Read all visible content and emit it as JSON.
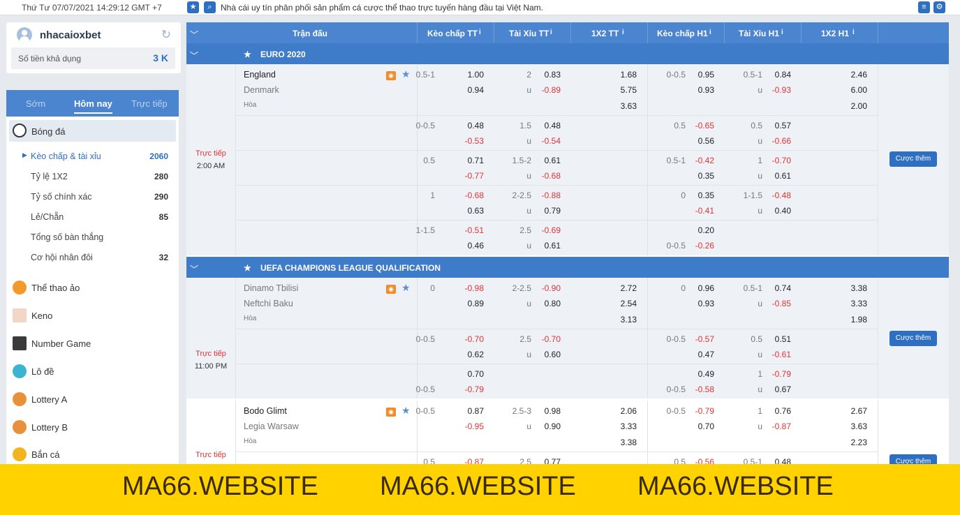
{
  "topbar": {
    "datetime": "Thứ Tư 07/07/2021 14:29:12 GMT +7",
    "ticker": "Nhà cái uy tín phân phối sản phẩm cá cược thể thao trực tuyến hàng đầu tại Việt Nam."
  },
  "user": {
    "name": "nhacaioxbet",
    "balance_label": "Số tiền khả dụng",
    "balance_value": "3 K"
  },
  "tabs": [
    "Sớm",
    "Hôm nay",
    "Trực tiếp"
  ],
  "sports": {
    "active": "Bóng đá",
    "subitems": [
      {
        "label": "Kèo chấp & tài xỉu",
        "count": "2060"
      },
      {
        "label": "Tỷ lệ 1X2",
        "count": "280"
      },
      {
        "label": "Tỷ số chính xác",
        "count": "290"
      },
      {
        "label": "Lẻ/Chẵn",
        "count": "85"
      },
      {
        "label": "Tổng số bàn thắng",
        "count": ""
      },
      {
        "label": "Cơ hội nhân đôi",
        "count": "32"
      }
    ],
    "others": [
      "Thể thao ảo",
      "Keno",
      "Number Game",
      "Lô đề",
      "Lottery A",
      "Lottery B",
      "Bắn cá"
    ]
  },
  "columns": [
    "Trận đấu",
    "Kèo chấp TT",
    "Tài Xỉu TT",
    "1X2 TT",
    "Kèo chấp H1",
    "Tài Xỉu H1",
    "1X2 H1"
  ],
  "leagues": [
    "EURO 2020",
    "UEFA CHAMPIONS LEAGUE QUALIFICATION"
  ],
  "live_label": "Trực tiếp",
  "more_label": "Cược thêm",
  "match1": {
    "home": "England",
    "away": "Denmark",
    "draw": "Hòa",
    "time": "2:00 AM"
  },
  "match2": {
    "home": "Dinamo Tbilisi",
    "away": "Neftchi Baku",
    "draw": "Hòa",
    "time": "11:00 PM"
  },
  "match3": {
    "home": "Bodo Glimt",
    "away": "Legia Warsaw",
    "draw": "Hòa"
  },
  "banner": "MA66.WEBSITE",
  "u": "u",
  "odds": {
    "m1": [
      [
        "0.5-1",
        "1.00",
        "2",
        "0.83",
        "1.68",
        "0-0.5",
        "0.95",
        "0.5-1",
        "0.84",
        "2.46"
      ],
      [
        "",
        "0.94",
        "u",
        "-0.89",
        "5.75",
        "",
        "0.93",
        "u",
        "-0.93",
        "6.00"
      ],
      [
        "",
        "",
        "",
        "",
        "3.63",
        "",
        "",
        "",
        "",
        "2.00"
      ],
      [
        "0-0.5",
        "0.48",
        "1.5",
        "0.48",
        "",
        "0.5",
        "-0.65",
        "0.5",
        "0.57",
        ""
      ],
      [
        "",
        "-0.53",
        "u",
        "-0.54",
        "",
        "",
        "0.56",
        "u",
        "-0.66",
        ""
      ],
      [
        "0.5",
        "0.71",
        "1.5-2",
        "0.61",
        "",
        "0.5-1",
        "-0.42",
        "1",
        "-0.70",
        ""
      ],
      [
        "",
        "-0.77",
        "u",
        "-0.68",
        "",
        "",
        "0.35",
        "u",
        "0.61",
        ""
      ],
      [
        "1",
        "-0.68",
        "2-2.5",
        "-0.88",
        "",
        "0",
        "0.35",
        "1-1.5",
        "-0.48",
        ""
      ],
      [
        "",
        "0.63",
        "u",
        "0.79",
        "",
        "",
        "-0.41",
        "u",
        "0.40",
        ""
      ],
      [
        "1-1.5",
        "-0.51",
        "2.5",
        "-0.69",
        "",
        "",
        "0.20",
        "",
        "",
        ""
      ],
      [
        "",
        "0.46",
        "u",
        "0.61",
        "",
        "0-0.5",
        "-0.26",
        "",
        "",
        ""
      ]
    ],
    "m2": [
      [
        "0",
        "-0.98",
        "2-2.5",
        "-0.90",
        "2.72",
        "0",
        "0.96",
        "0.5-1",
        "0.74",
        "3.38"
      ],
      [
        "",
        "0.89",
        "u",
        "0.80",
        "2.54",
        "",
        "0.93",
        "u",
        "-0.85",
        "3.33"
      ],
      [
        "",
        "",
        "",
        "",
        "3.13",
        "",
        "",
        "",
        "",
        "1.98"
      ],
      [
        "0-0.5",
        "-0.70",
        "2.5",
        "-0.70",
        "",
        "0-0.5",
        "-0.57",
        "0.5",
        "0.51",
        ""
      ],
      [
        "",
        "0.62",
        "u",
        "0.60",
        "",
        "",
        "0.47",
        "u",
        "-0.61",
        ""
      ],
      [
        "",
        "0.70",
        "",
        "",
        "",
        "",
        "0.49",
        "1",
        "-0.79",
        ""
      ],
      [
        "0-0.5",
        "-0.79",
        "",
        "",
        "",
        "0-0.5",
        "-0.58",
        "u",
        "0.67",
        ""
      ]
    ],
    "m3": [
      [
        "0-0.5",
        "0.87",
        "2.5-3",
        "0.98",
        "2.06",
        "0-0.5",
        "-0.79",
        "1",
        "0.76",
        "2.67"
      ],
      [
        "",
        "-0.95",
        "u",
        "0.90",
        "3.33",
        "",
        "0.70",
        "u",
        "-0.87",
        "3.63"
      ],
      [
        "",
        "",
        "",
        "",
        "3.38",
        "",
        "",
        "",
        "",
        "2.23"
      ],
      [
        "0.5",
        "-0.87",
        "2.5",
        "0.77",
        "",
        "0.5",
        "-0.56",
        "0.5-1",
        "0.48",
        ""
      ]
    ]
  }
}
